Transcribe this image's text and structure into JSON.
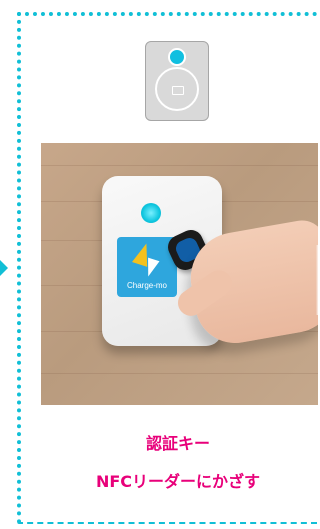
{
  "ui": {
    "accent_color": "#11bfd6",
    "text_color": "#e8007a",
    "device_led_color": "#11bfe0"
  },
  "photo": {
    "panel_label": "Charge-mo"
  },
  "caption": {
    "line1": "認証キー",
    "line2": "NFCリーダーにかざす"
  },
  "icons": {
    "arrow": "triangle-right-icon",
    "device": "charger-device-icon",
    "led": "led-indicator-icon",
    "reader": "nfc-reader-icon"
  }
}
